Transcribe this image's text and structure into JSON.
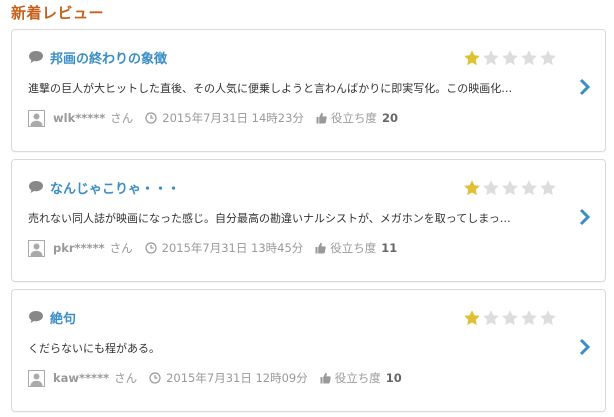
{
  "section": {
    "title": "新着レビュー"
  },
  "colors": {
    "title_accent": "#c8601c",
    "link": "#3a8ec5",
    "star_filled": "#e0c035",
    "star_empty": "#dddddd"
  },
  "reviews": [
    {
      "title": "邦画の終わりの象徴",
      "rating": 1,
      "rating_max": 5,
      "excerpt": "進撃の巨人が大ヒットした直後、その人気に便乗しようと言わんばかりに即実写化。この映画化…",
      "user": "wlk*****",
      "user_suffix": "さん",
      "date": "2015年7月31日 14時23分",
      "helpful_label": "役立ち度",
      "helpful_count": "20"
    },
    {
      "title": "なんじゃこりゃ・・・",
      "rating": 1,
      "rating_max": 5,
      "excerpt": "売れない同人誌が映画になった感じ。自分最高の勘違いナルシストが、メガホンを取ってしまっ…",
      "user": "pkr*****",
      "user_suffix": "さん",
      "date": "2015年7月31日 13時45分",
      "helpful_label": "役立ち度",
      "helpful_count": "11"
    },
    {
      "title": "絶句",
      "rating": 1,
      "rating_max": 5,
      "excerpt": "くだらないにも程がある。",
      "user": "kaw*****",
      "user_suffix": "さん",
      "date": "2015年7月31日 12時09分",
      "helpful_label": "役立ち度",
      "helpful_count": "10"
    }
  ]
}
